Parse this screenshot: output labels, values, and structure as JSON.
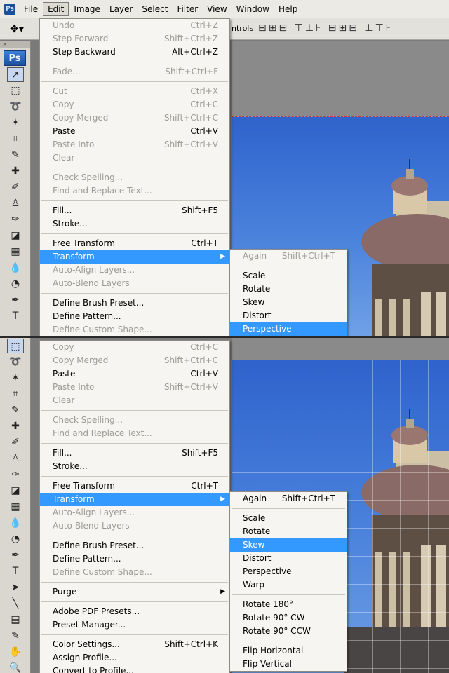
{
  "menubar": {
    "items": [
      "File",
      "Edit",
      "Image",
      "Layer",
      "Select",
      "Filter",
      "View",
      "Window",
      "Help"
    ],
    "active": "Edit"
  },
  "optbar": {
    "controls_label": "ntrols"
  },
  "app_logo": "Ps",
  "panel1": {
    "edit_menu": [
      {
        "label": "Undo",
        "shortcut": "Ctrl+Z",
        "disabled": true
      },
      {
        "label": "Step Forward",
        "shortcut": "Shift+Ctrl+Z",
        "disabled": true
      },
      {
        "label": "Step Backward",
        "shortcut": "Alt+Ctrl+Z"
      },
      {
        "sep": true
      },
      {
        "label": "Fade...",
        "shortcut": "Shift+Ctrl+F",
        "disabled": true
      },
      {
        "sep": true
      },
      {
        "label": "Cut",
        "shortcut": "Ctrl+X",
        "disabled": true
      },
      {
        "label": "Copy",
        "shortcut": "Ctrl+C",
        "disabled": true
      },
      {
        "label": "Copy Merged",
        "shortcut": "Shift+Ctrl+C",
        "disabled": true
      },
      {
        "label": "Paste",
        "shortcut": "Ctrl+V"
      },
      {
        "label": "Paste Into",
        "shortcut": "Shift+Ctrl+V",
        "disabled": true
      },
      {
        "label": "Clear",
        "disabled": true
      },
      {
        "sep": true
      },
      {
        "label": "Check Spelling...",
        "disabled": true
      },
      {
        "label": "Find and Replace Text...",
        "disabled": true
      },
      {
        "sep": true
      },
      {
        "label": "Fill...",
        "shortcut": "Shift+F5"
      },
      {
        "label": "Stroke..."
      },
      {
        "sep": true
      },
      {
        "label": "Free Transform",
        "shortcut": "Ctrl+T"
      },
      {
        "label": "Transform",
        "submenu": true,
        "highlighted": true
      },
      {
        "label": "Auto-Align Layers...",
        "disabled": true
      },
      {
        "label": "Auto-Blend Layers",
        "disabled": true
      },
      {
        "sep": true
      },
      {
        "label": "Define Brush Preset..."
      },
      {
        "label": "Define Pattern..."
      },
      {
        "label": "Define Custom Shape...",
        "disabled": true
      }
    ],
    "transform_menu": [
      {
        "label": "Again",
        "shortcut": "Shift+Ctrl+T",
        "disabled": true
      },
      {
        "sep": true
      },
      {
        "label": "Scale"
      },
      {
        "label": "Rotate"
      },
      {
        "label": "Skew"
      },
      {
        "label": "Distort"
      },
      {
        "label": "Perspective",
        "highlighted": true
      }
    ]
  },
  "panel2": {
    "edit_menu": [
      {
        "label": "Copy",
        "shortcut": "Ctrl+C",
        "disabled": true
      },
      {
        "label": "Copy Merged",
        "shortcut": "Shift+Ctrl+C",
        "disabled": true
      },
      {
        "label": "Paste",
        "shortcut": "Ctrl+V"
      },
      {
        "label": "Paste Into",
        "shortcut": "Shift+Ctrl+V",
        "disabled": true
      },
      {
        "label": "Clear",
        "disabled": true
      },
      {
        "sep": true
      },
      {
        "label": "Check Spelling...",
        "disabled": true
      },
      {
        "label": "Find and Replace Text...",
        "disabled": true
      },
      {
        "sep": true
      },
      {
        "label": "Fill...",
        "shortcut": "Shift+F5"
      },
      {
        "label": "Stroke..."
      },
      {
        "sep": true
      },
      {
        "label": "Free Transform",
        "shortcut": "Ctrl+T"
      },
      {
        "label": "Transform",
        "submenu": true,
        "highlighted": true
      },
      {
        "label": "Auto-Align Layers...",
        "disabled": true
      },
      {
        "label": "Auto-Blend Layers",
        "disabled": true
      },
      {
        "sep": true
      },
      {
        "label": "Define Brush Preset..."
      },
      {
        "label": "Define Pattern..."
      },
      {
        "label": "Define Custom Shape...",
        "disabled": true
      },
      {
        "sep": true
      },
      {
        "label": "Purge",
        "submenu": true
      },
      {
        "sep": true
      },
      {
        "label": "Adobe PDF Presets..."
      },
      {
        "label": "Preset Manager..."
      },
      {
        "sep": true
      },
      {
        "label": "Color Settings...",
        "shortcut": "Shift+Ctrl+K"
      },
      {
        "label": "Assign Profile..."
      },
      {
        "label": "Convert to Profile..."
      }
    ],
    "transform_menu": [
      {
        "label": "Again",
        "shortcut": "Shift+Ctrl+T"
      },
      {
        "sep": true
      },
      {
        "label": "Scale"
      },
      {
        "label": "Rotate"
      },
      {
        "label": "Skew",
        "highlighted": true
      },
      {
        "label": "Distort"
      },
      {
        "label": "Perspective"
      },
      {
        "label": "Warp"
      },
      {
        "sep": true
      },
      {
        "label": "Rotate 180°"
      },
      {
        "label": "Rotate 90° CW"
      },
      {
        "label": "Rotate 90° CCW"
      },
      {
        "sep": true
      },
      {
        "label": "Flip Horizontal"
      },
      {
        "label": "Flip Vertical"
      }
    ]
  },
  "colors": {
    "highlight": "#3399ff",
    "sky": "#3f75d6"
  }
}
